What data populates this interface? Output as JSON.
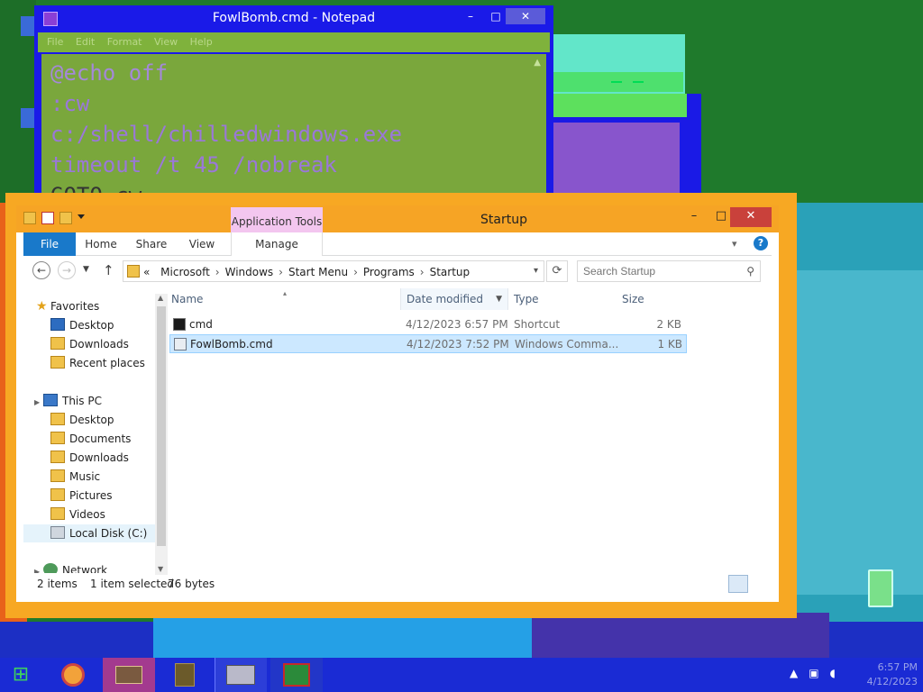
{
  "notepad": {
    "title": "FowlBomb.cmd - Notepad",
    "menu": [
      "File",
      "Edit",
      "Format",
      "View",
      "Help"
    ],
    "lines": [
      "@echo off",
      ":cw",
      "c:/shell/chilledwindows.exe",
      "timeout /t 45 /nobreak",
      "GOTO cw"
    ],
    "controls": {
      "minimize": "–",
      "maximize": "□",
      "close": "✕"
    }
  },
  "explorer": {
    "title": "Startup",
    "contextual_tab_group": "Application Tools",
    "controls": {
      "minimize": "–",
      "maximize": "□",
      "close": "✕"
    },
    "ribbon_tabs": [
      "File",
      "Home",
      "Share",
      "View",
      "Manage"
    ],
    "help": "?",
    "address": {
      "overflow": "«",
      "crumbs": [
        "Microsoft",
        "Windows",
        "Start Menu",
        "Programs",
        "Startup"
      ],
      "separator": "›"
    },
    "search_placeholder": "Search Startup",
    "nav_pane": {
      "favorites_label": "Favorites",
      "favorites": [
        "Desktop",
        "Downloads",
        "Recent places"
      ],
      "this_pc_label": "This PC",
      "this_pc": [
        "Desktop",
        "Documents",
        "Downloads",
        "Music",
        "Pictures",
        "Videos",
        "Local Disk (C:)"
      ],
      "network_label": "Network"
    },
    "columns": {
      "name": "Name",
      "date": "Date modified",
      "type": "Type",
      "size": "Size"
    },
    "files": [
      {
        "name": "cmd",
        "date": "4/12/2023 6:57 PM",
        "type": "Shortcut",
        "size": "2 KB",
        "selected": false
      },
      {
        "name": "FowlBomb.cmd",
        "date": "4/12/2023 7:52 PM",
        "type": "Windows Comma...",
        "size": "1 KB",
        "selected": true
      }
    ],
    "status": {
      "items": "2 items",
      "selected": "1 item selected",
      "size": "76 bytes"
    }
  },
  "taskbar": {
    "clock_time": "6:57 PM",
    "clock_date": "4/12/2023"
  },
  "colors": {
    "explorer_frame": "#f7a823",
    "notepad_frame": "#1a1ae8",
    "notepad_text_bg": "#7aa73c",
    "file_tab": "#1979ca",
    "selection": "#cce8ff",
    "close_button": "#c9413b"
  }
}
